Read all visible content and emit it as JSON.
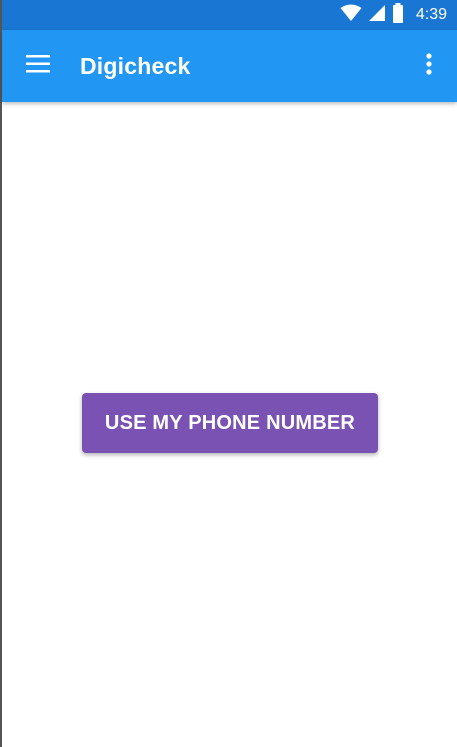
{
  "status_bar": {
    "time": "4:39",
    "icons": [
      "wifi-icon",
      "cell-signal-icon",
      "battery-icon"
    ],
    "color": "#1976D2"
  },
  "app_bar": {
    "title": "Digicheck",
    "menu_icon": "hamburger-menu-icon",
    "overflow_icon": "more-vertical-icon",
    "color": "#2196F3"
  },
  "main": {
    "phone_button_label": "USE MY PHONE NUMBER",
    "phone_button_color": "#7952B3"
  }
}
